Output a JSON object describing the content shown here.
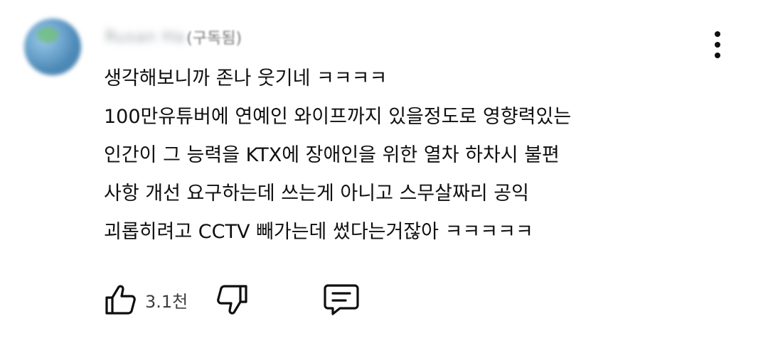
{
  "comment": {
    "author": {
      "name": "Rusan Ha",
      "suffix": "(구독됨)"
    },
    "lines": [
      "생각해보니까 존나 웃기네 ㅋㅋㅋㅋ",
      "100만유튜버에 연예인 와이프까지 있을정도로 영향력있는",
      "인간이 그 능력을 KTX에 장애인을 위한 열차 하차시 불편",
      "사항 개선 요구하는데 쓰는게 아니고 스무살짜리 공익",
      "괴롭히려고 CCTV 빼가는데 썼다는거잖아 ㅋㅋㅋㅋㅋ"
    ],
    "like_count": "3.1천",
    "icons": {
      "like": "thumbs-up-icon",
      "dislike": "thumbs-down-icon",
      "reply": "comment-icon",
      "more": "more-vertical-icon"
    }
  }
}
